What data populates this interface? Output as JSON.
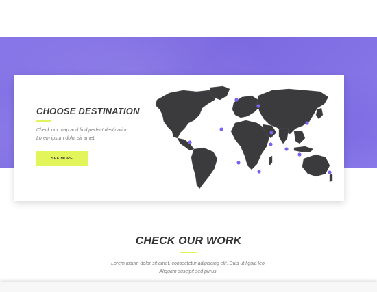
{
  "destination": {
    "title": "CHOOSE DESTINATION",
    "text_line1": "Check our map and find perfect destination.",
    "text_line2": "Lorem ipsum dolor sit amet.",
    "button_label": "SEE MORE"
  },
  "work": {
    "title": "CHECK OUR WORK",
    "text_line1": "Lorem ipsum dolor sit amet, consectetur adipiscing elit. Duis ut ligula leo.",
    "text_line2": "Aliquam suscipit sed purus."
  },
  "colors": {
    "band_purple": "#7b68e0",
    "accent_lime": "#e2f55a",
    "map_land": "#3b3b3d",
    "marker_purple": "#7a63f0"
  },
  "map": {
    "marker_count": 12
  }
}
